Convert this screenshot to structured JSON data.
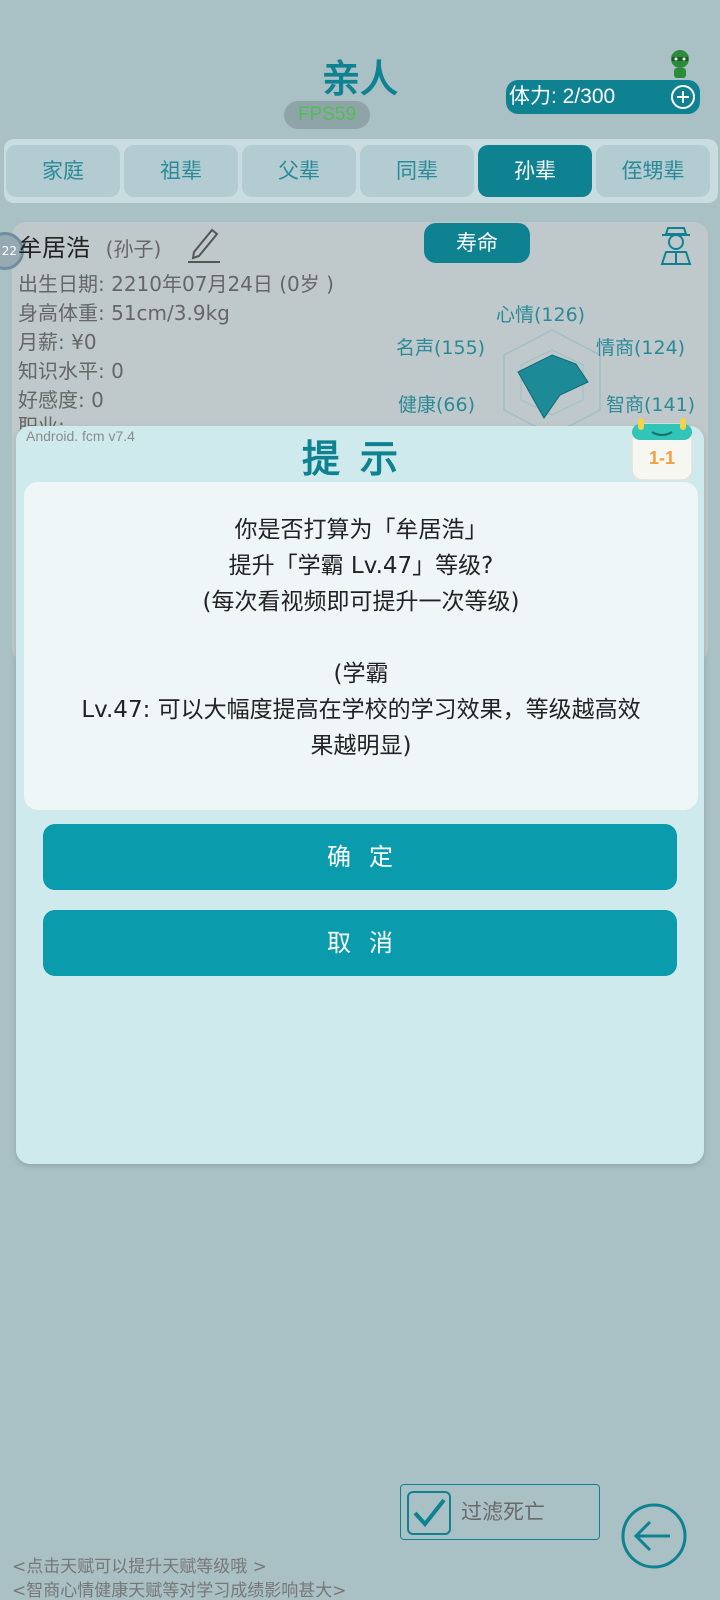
{
  "header": {
    "title": "亲人",
    "fps": "FPS59",
    "stamina": "体力: 2/300"
  },
  "tabs": [
    {
      "label": "家庭",
      "active": false
    },
    {
      "label": "祖辈",
      "active": false
    },
    {
      "label": "父辈",
      "active": false
    },
    {
      "label": "同辈",
      "active": false
    },
    {
      "label": "孙辈",
      "active": true
    },
    {
      "label": "侄甥辈",
      "active": false
    }
  ],
  "profile": {
    "name": "牟居浩",
    "relation": "(孙子)",
    "level_badge": "22",
    "lifespan_button": "寿命",
    "birth": "出生日期: 2210年07月24日 (0岁 )",
    "body": "身高体重: 51cm/3.9kg",
    "salary": "月薪: ¥0",
    "knowledge": "知识水平: 0",
    "favor": "好感度: 0",
    "job": "职业:"
  },
  "radar": {
    "mood": "心情(126)",
    "fame": "名声(155)",
    "eq": "情商(124)",
    "health": "健康(66)",
    "iq": "智商(141)"
  },
  "dialog": {
    "version": "Android. fcm v7.4",
    "title": "提示",
    "calendar_label": "1-1",
    "line1": "你是否打算为「牟居浩」",
    "line2": "提升「学霸 Lv.47」等级?",
    "line3": "(每次看视频即可提升一次等级)",
    "line4": "(学霸",
    "line5": "Lv.47: 可以大幅度提高在学校的学习效果，等级越高效",
    "line6": "果越明显)",
    "confirm": "确定",
    "cancel": "取消"
  },
  "footer": {
    "filter_label": "过滤死亡",
    "filter_checked": true,
    "hint1": "<点击天赋可以提升天赋等级哦 >",
    "hint2": "<智商心情健康天赋等对学习成绩影响甚大>"
  },
  "colors": {
    "accent": "#0f8292",
    "button": "#0a9bad",
    "background": "#a9c0c5",
    "dialog": "#cfeaed"
  }
}
